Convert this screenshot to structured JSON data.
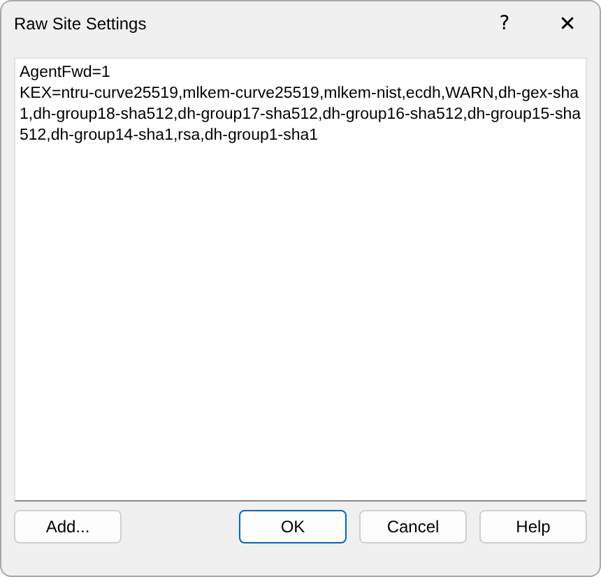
{
  "window": {
    "title": "Raw Site Settings",
    "help_glyph": "?",
    "close_glyph": "✕"
  },
  "settings_text": {
    "lines": [
      "AgentFwd=1",
      "KEX=ntru-curve25519,mlkem-curve25519,mlkem-nist,ecdh,WARN,dh-gex-sha1,dh-group18-sha512,dh-group17-sha512,dh-group16-sha512,dh-group15-sha512,dh-group14-sha1,rsa,dh-group1-sha1"
    ]
  },
  "left_button": {
    "label": "Add...",
    "default": false
  },
  "buttons": [
    {
      "label": "OK",
      "default": true
    },
    {
      "label": "Cancel",
      "default": false
    },
    {
      "label": "Help",
      "default": false
    }
  ]
}
